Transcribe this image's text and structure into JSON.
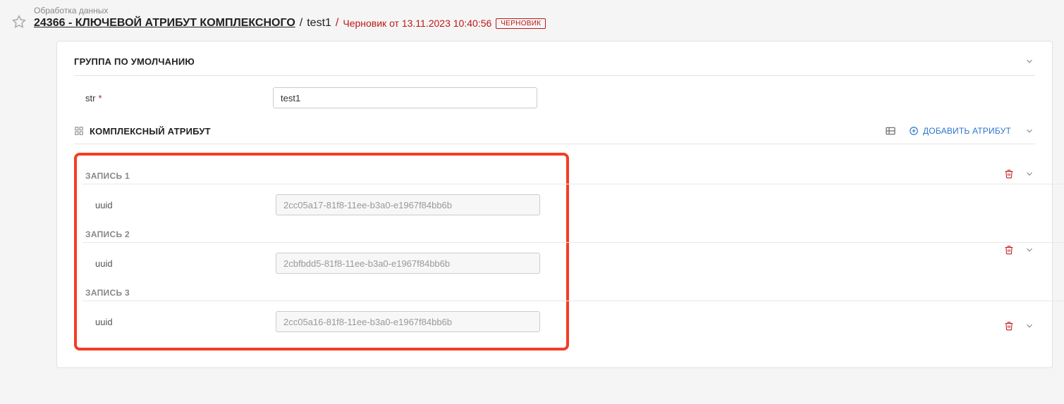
{
  "header": {
    "breadcrumb": "Обработка данных",
    "title_main": "24366 - КЛЮЧЕВОЙ АТРИБУТ КОМПЛЕКСНОГО",
    "title_sub": "test1",
    "draft_text": "Черновик от 13.11.2023 10:40:56",
    "draft_badge": "ЧЕРНОВИК"
  },
  "group": {
    "title": "ГРУППА ПО УМОЛЧАНИЮ",
    "field_label": "str",
    "field_required": "*",
    "field_value": "test1"
  },
  "complex": {
    "title": "КОМПЛЕКСНЫЙ АТРИБУТ",
    "add_label": "ДОБАВИТЬ АТРИБУТ",
    "records": [
      {
        "title": "ЗАПИСЬ 1",
        "label": "uuid",
        "value": "2cc05a17-81f8-11ee-b3a0-e1967f84bb6b"
      },
      {
        "title": "ЗАПИСЬ 2",
        "label": "uuid",
        "value": "2cbfbdd5-81f8-11ee-b3a0-e1967f84bb6b"
      },
      {
        "title": "ЗАПИСЬ 3",
        "label": "uuid",
        "value": "2cc05a16-81f8-11ee-b3a0-e1967f84bb6b"
      }
    ]
  }
}
